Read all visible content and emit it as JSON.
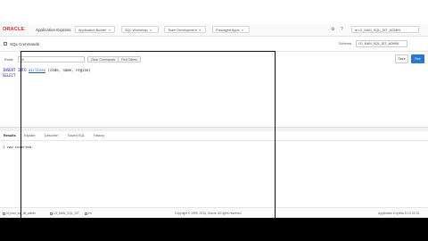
{
  "header": {
    "logo": "ORACLE",
    "app_name": "Application Express",
    "tabs": [
      {
        "label": "Application Builder"
      },
      {
        "label": "SQL Workshop"
      },
      {
        "label": "Team Development"
      },
      {
        "label": "Packaged Apps"
      }
    ],
    "user": "LD_MAN_SQL_DIT_ADMIN"
  },
  "page": {
    "title": "SQL Commands",
    "schema_label": "Schema",
    "schema_value": "LD_MAN_SQL_DIT_ADMIN"
  },
  "toolbar": {
    "rows_label": "Rows",
    "rows_value": "10",
    "clear_label": "Clear Commands",
    "find_label": "Find Tables",
    "save_label": "Save",
    "run_label": "Run"
  },
  "editor": {
    "lines": [
      {
        "kw": "INSERT INTO ",
        "fn": "airlines",
        "rest": " (code, name, region)"
      },
      {
        "kw": "SELECT",
        "fn": "",
        "rest": ""
      }
    ]
  },
  "results": {
    "tabs": [
      "Results",
      "Explain",
      "Describe",
      "Saved SQL",
      "History"
    ],
    "active_tab": "Results",
    "output": "1 row inserted."
  },
  "footer": {
    "user": "ld_man_sql_dit_admin",
    "schema": "LD_MAN_SQL_DIT",
    "language": "en",
    "copyright": "Copyright © 1999, 2015, Oracle. All rights reserved.",
    "version": "Application Express 5.0.0.00.31"
  }
}
